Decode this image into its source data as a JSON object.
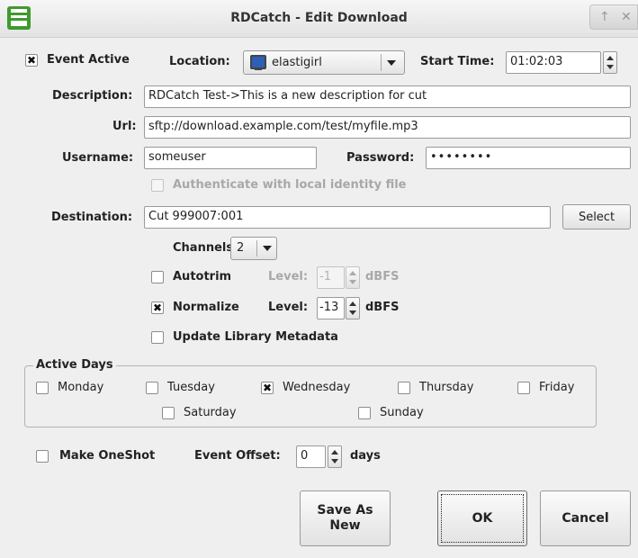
{
  "window": {
    "title": "RDCatch - Edit Download",
    "controls": [
      "↑",
      "✕"
    ]
  },
  "event_active": {
    "label": "Event Active",
    "checked": true
  },
  "location": {
    "label": "Location:",
    "value": "elastigirl",
    "icon": "monitor-icon"
  },
  "start_time": {
    "label": "Start Time:",
    "value": "01:02:03"
  },
  "description": {
    "label": "Description:",
    "value": "RDCatch Test->This is a new description for cut"
  },
  "url": {
    "label": "Url:",
    "value": "sftp://download.example.com/test/myfile.mp3"
  },
  "username": {
    "label": "Username:",
    "value": "someuser"
  },
  "password": {
    "label": "Password:",
    "value": "••••••••"
  },
  "auth_identity": {
    "label": "Authenticate with local identity file",
    "checked": false,
    "enabled": false
  },
  "destination": {
    "label": "Destination:",
    "value": "Cut 999007:001",
    "select_label": "Select"
  },
  "channels": {
    "label": "Channels:",
    "value": "2"
  },
  "autotrim": {
    "label": "Autotrim",
    "checked": false,
    "level_label": "Level:",
    "level": "-1",
    "unit": "dBFS"
  },
  "normalize": {
    "label": "Normalize",
    "checked": true,
    "level_label": "Level:",
    "level": "-13",
    "unit": "dBFS"
  },
  "update_metadata": {
    "label": "Update Library Metadata",
    "checked": false
  },
  "active_days": {
    "title": "Active Days",
    "days": [
      {
        "label": "Monday",
        "checked": false
      },
      {
        "label": "Tuesday",
        "checked": false
      },
      {
        "label": "Wednesday",
        "checked": true
      },
      {
        "label": "Thursday",
        "checked": false
      },
      {
        "label": "Friday",
        "checked": false
      },
      {
        "label": "Saturday",
        "checked": false
      },
      {
        "label": "Sunday",
        "checked": false
      }
    ]
  },
  "oneshot": {
    "label": "Make OneShot",
    "checked": false
  },
  "event_offset": {
    "label": "Event Offset:",
    "value": "0",
    "unit": "days"
  },
  "buttons": {
    "save_as_new": "Save As\nNew",
    "ok": "OK",
    "cancel": "Cancel"
  },
  "check_mark": "✖"
}
